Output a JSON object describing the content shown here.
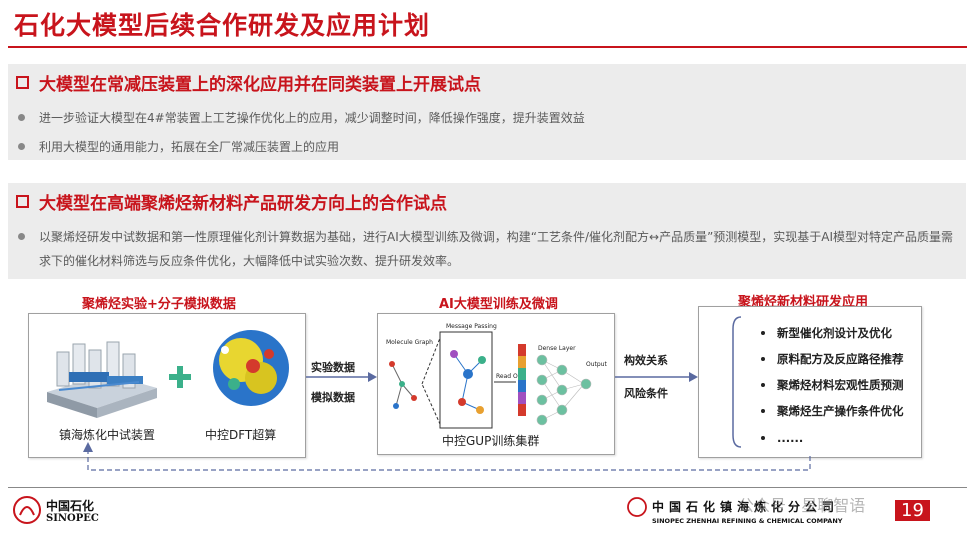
{
  "slide": {
    "title": "石化大模型后续合作研发及应用计划",
    "page_number": "19"
  },
  "section1": {
    "heading": "大模型在常减压装置上的深化应用并在同类装置上开展试点",
    "bullets": [
      "进一步验证大模型在4#常装置上工艺操作优化上的应用，减少调整时间，降低操作强度，提升装置效益",
      "利用大模型的通用能力，拓展在全厂常减压装置上的应用"
    ]
  },
  "section2": {
    "heading": "大模型在高端聚烯烃新材料产品研发方向上的合作试点",
    "bullets": [
      "以聚烯烃研发中试数据和第一性原理催化剂计算数据为基础，进行AI大模型训练及微调，构建“工艺条件/催化剂配方↔产品质量”预测模型，实现基于AI模型对特定产品质量需求下的催化材料筛选与反应条件优化，大幅降低中试实验次数、提升研发效率。"
    ]
  },
  "diagram": {
    "left": {
      "label": "聚烯烃实验+分子模拟数据",
      "caption_left": "镇海炼化中试装置",
      "caption_right": "中控DFT超算"
    },
    "arrow1": {
      "top": "实验数据",
      "bottom": "模拟数据"
    },
    "middle": {
      "label": "AI大模型训练及微调",
      "caption": "中控GUP训练集群",
      "nn_labels": {
        "graph": "Molecule Graph",
        "message": "Message Passing",
        "readout": "Read Out",
        "dense": "Dense Layer",
        "output": "Output"
      }
    },
    "arrow2": {
      "top": "构效关系",
      "bottom": "风险条件"
    },
    "right": {
      "label": "聚烯烃新材料研发应用",
      "items": [
        "新型催化剂设计及优化",
        "原料配方及反应路径推荐",
        "聚烯烃材料宏观性质预测",
        "聚烯烃生产操作条件优化",
        "......"
      ]
    }
  },
  "footer": {
    "left_logo_cn": "中国石化",
    "left_logo_en": "SINOPEC",
    "right_logo_cn": "中国石化镇海炼化分公司",
    "right_logo_en": "SINOPEC ZHENHAI REFINING & CHEMICAL COMPANY",
    "watermark": "公众号 · 星聊智语"
  },
  "colors": {
    "accent": "#c8141c",
    "panel": "#ececec",
    "arrow": "#5a6aa0"
  }
}
